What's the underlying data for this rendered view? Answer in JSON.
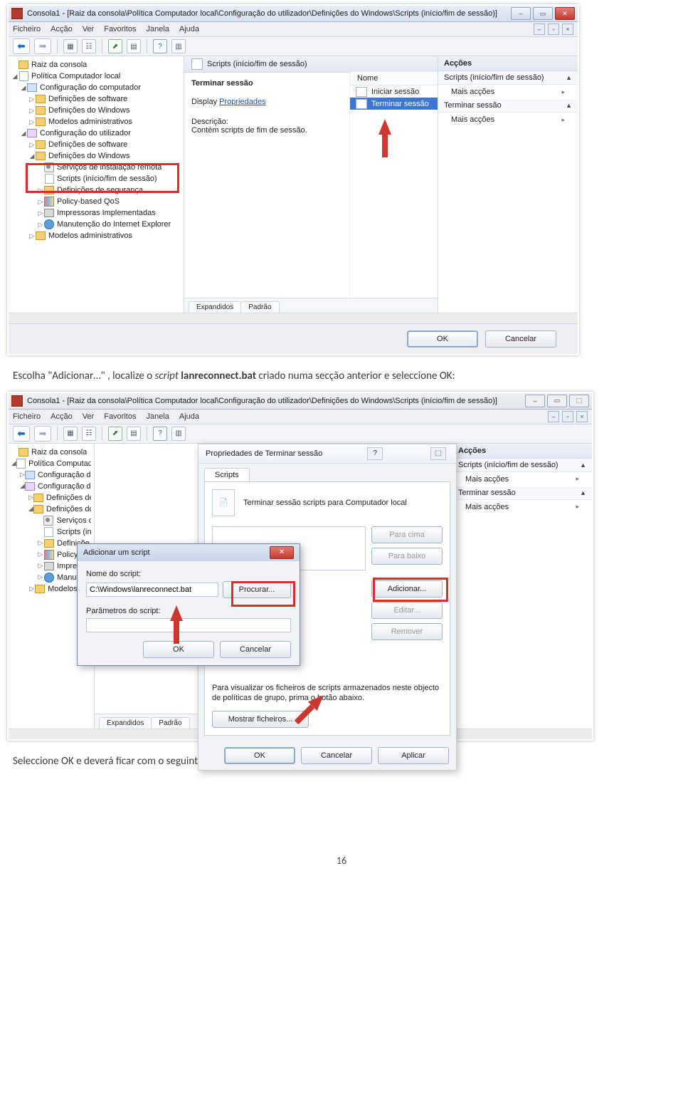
{
  "page_number": "16",
  "text_line_1a": "Escolha \"Adicionar…\" , localize o ",
  "text_line_1b": "script",
  "text_line_1c": " lanreconnect.bat",
  "text_line_1d": " criado numa secção anterior e seleccione OK:",
  "text_line_2": "Seleccione OK e deverá ficar com o seguinte resultado:",
  "shot1": {
    "title": "Consola1 - [Raiz da consola\\Política Computador local\\Configuração do utilizador\\Definições do Windows\\Scripts (início/fim de sessão)]",
    "menus": [
      "Ficheiro",
      "Acção",
      "Ver",
      "Favoritos",
      "Janela",
      "Ajuda"
    ],
    "tree": {
      "root": "Raiz da consola",
      "pol": "Política Computador local",
      "comp": "Configuração do computador",
      "c1": "Definições de software",
      "c2": "Definições do Windows",
      "c3": "Modelos administrativos",
      "user": "Configuração do utilizador",
      "u1": "Definições de software",
      "u2": "Definições do Windows",
      "u2a": "Serviços de instalação remota",
      "u2b": "Scripts (início/fim de sessão)",
      "u2c": "Definições de segurança",
      "u2d": "Policy-based QoS",
      "u2e": "Impressoras Implementadas",
      "u2f": "Manutenção do Internet Explorer",
      "u3": "Modelos administrativos"
    },
    "mid": {
      "header": "Scripts (início/fim de sessão)",
      "left_title": "Terminar sessão",
      "disp": "Display ",
      "disp_link": "Propriedades",
      "desc_h": "Descrição:",
      "desc_b": "Contém scripts de fim de sessão.",
      "col": "Nome",
      "item1": "Iniciar sessão",
      "item2": "Terminar sessão",
      "tab1": "Expandidos",
      "tab2": "Padrão"
    },
    "actions": {
      "h": "Acções",
      "g1": "Scripts (início/fim de sessão)",
      "i1": "Mais acções",
      "g2": "Terminar sessão",
      "i2": "Mais acções"
    },
    "btns": {
      "ok": "OK",
      "cancel": "Cancelar"
    }
  },
  "shot2": {
    "title": "Consola1 - [Raiz da consola\\Política Computador local\\Configuração do utilizador\\Definições do Windows\\Scripts (início/fim de sessão)]",
    "menus": [
      "Ficheiro",
      "Acção",
      "Ver",
      "Favoritos",
      "Janela",
      "Ajuda"
    ],
    "tree": {
      "root": "Raiz da consola",
      "pol": "Política Computador local",
      "comp": "Configuração do computador",
      "user": "Configuração do utilizador",
      "u1": "Definições de software",
      "u2": "Definições do Windows",
      "u2a_t": "Serviços d",
      "u2b_t": "Scripts (in",
      "u2c_t": "Definiçõe",
      "u2d_t": "Policy-ba",
      "u2e_t": "Impresso",
      "u2f_t": "Manuten",
      "u3_t": "Modelos adm"
    },
    "prop": {
      "title": "Propriedades de Terminar sessão",
      "tab": "Scripts",
      "line": "Terminar sessão scripts para Computador local",
      "up": "Para cima",
      "down": "Para baixo",
      "add": "Adicionar...",
      "edit": "Editar...",
      "rem": "Remover",
      "note": "Para visualizar os ficheiros de scripts armazenados neste objecto de políticas de grupo, prima o botão abaixo.",
      "show": "Mostrar ficheiros...",
      "ok": "OK",
      "cancel": "Cancelar",
      "apply": "Aplicar"
    },
    "mid_tabs": {
      "t1": "Expandidos",
      "t2": "Padrão"
    },
    "add": {
      "title": "Adicionar um script",
      "l1": "Nome do script:",
      "val": "C:\\Windows\\lanreconnect.bat",
      "browse": "Procurar...",
      "l2": "Parâmetros do script:",
      "ok": "OK",
      "cancel": "Cancelar"
    },
    "actions": {
      "h": "Acções",
      "g1": "Scripts (início/fim de sessão)",
      "i1": "Mais acções",
      "g2": "Terminar sessão",
      "i2": "Mais acções"
    }
  }
}
